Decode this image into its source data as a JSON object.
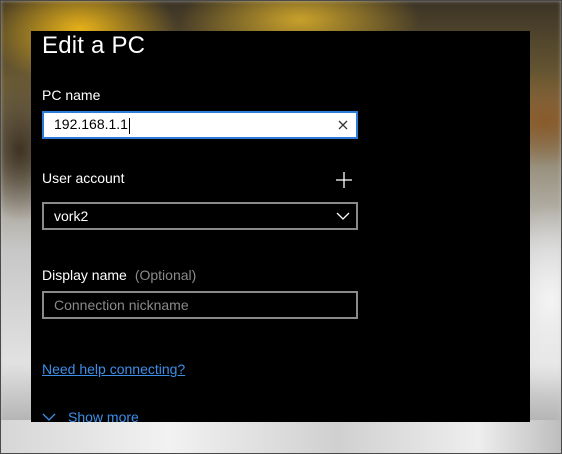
{
  "dialog": {
    "title": "Edit a PC",
    "pc_name": {
      "label": "PC name",
      "value": "192.168.1.1"
    },
    "user_account": {
      "label": "User account",
      "selected": "vork2"
    },
    "display_name": {
      "label": "Display name",
      "optional_tag": "(Optional)",
      "placeholder": "Connection nickname",
      "value": ""
    },
    "help_link": "Need help connecting?",
    "show_more": "Show more"
  },
  "icons": {
    "clear": "close-icon",
    "add": "plus-icon",
    "dropdown": "chevron-down-icon",
    "expand": "chevron-down-icon"
  },
  "colors": {
    "panel_background": "#000000",
    "focus_border": "#2b7bd8",
    "link": "#3c8fe8",
    "field_border": "#8a8a8a"
  }
}
